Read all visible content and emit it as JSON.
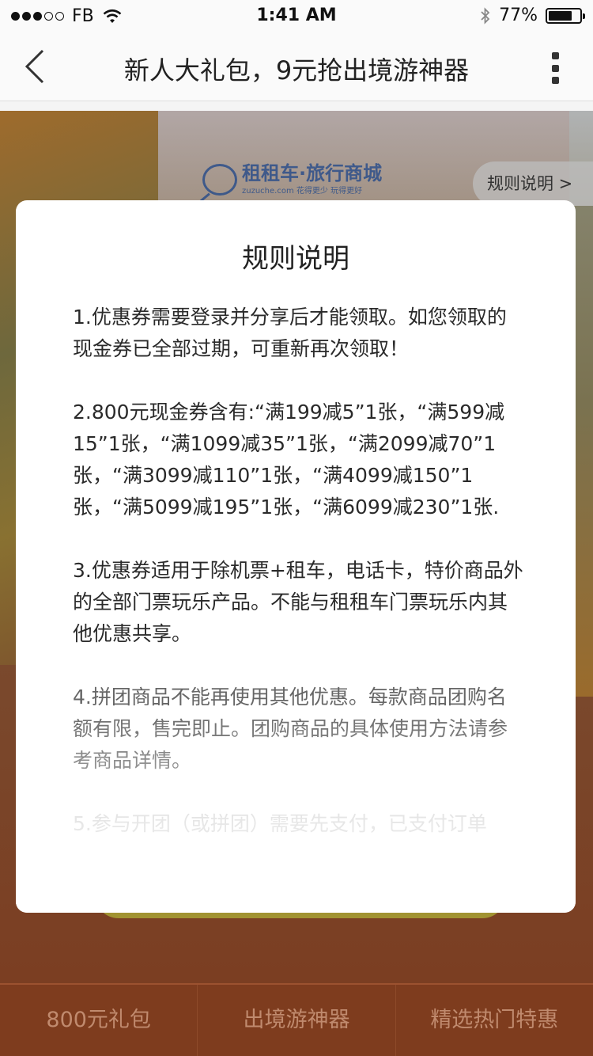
{
  "status_bar": {
    "carrier": "FB",
    "time": "1:41 AM",
    "battery": "77%",
    "battery_level": 0.77
  },
  "nav": {
    "title": "新人大礼包，9元抢出境游神器"
  },
  "background": {
    "logo_brand": "租租车·旅行商城",
    "logo_domain": "zuzuche.com",
    "logo_slogan": "花得更少  玩得更好",
    "rules_tab_label": "规则说明 >"
  },
  "modal": {
    "title": "规则说明",
    "rules": [
      "1.优惠券需要登录并分享后才能领取。如您领取的现金券已全部过期，可重新再次领取！",
      "2.800元现金券含有:“满199减5”1张，“满599减15”1张，“满1099减35”1张，“满2099减70”1张，“满3099减110”1张，“满4099减150”1张，“满5099减195”1张，“满6099减230”1张.",
      "3.优惠券适用于除机票+租车，电话卡，特价商品外的全部门票玩乐产品。不能与租租车门票玩乐内其他优惠共享。",
      "4.拼团商品不能再使用其他优惠。每款商品团购名额有限，售完即止。团购商品的具体使用方法请参考商品详情。",
      "5.参与开团（或拼团）需要先支付，已支付订单"
    ]
  },
  "tabbar": {
    "tabs": [
      "800元礼包",
      "出境游神器",
      "精选热门特惠"
    ]
  }
}
